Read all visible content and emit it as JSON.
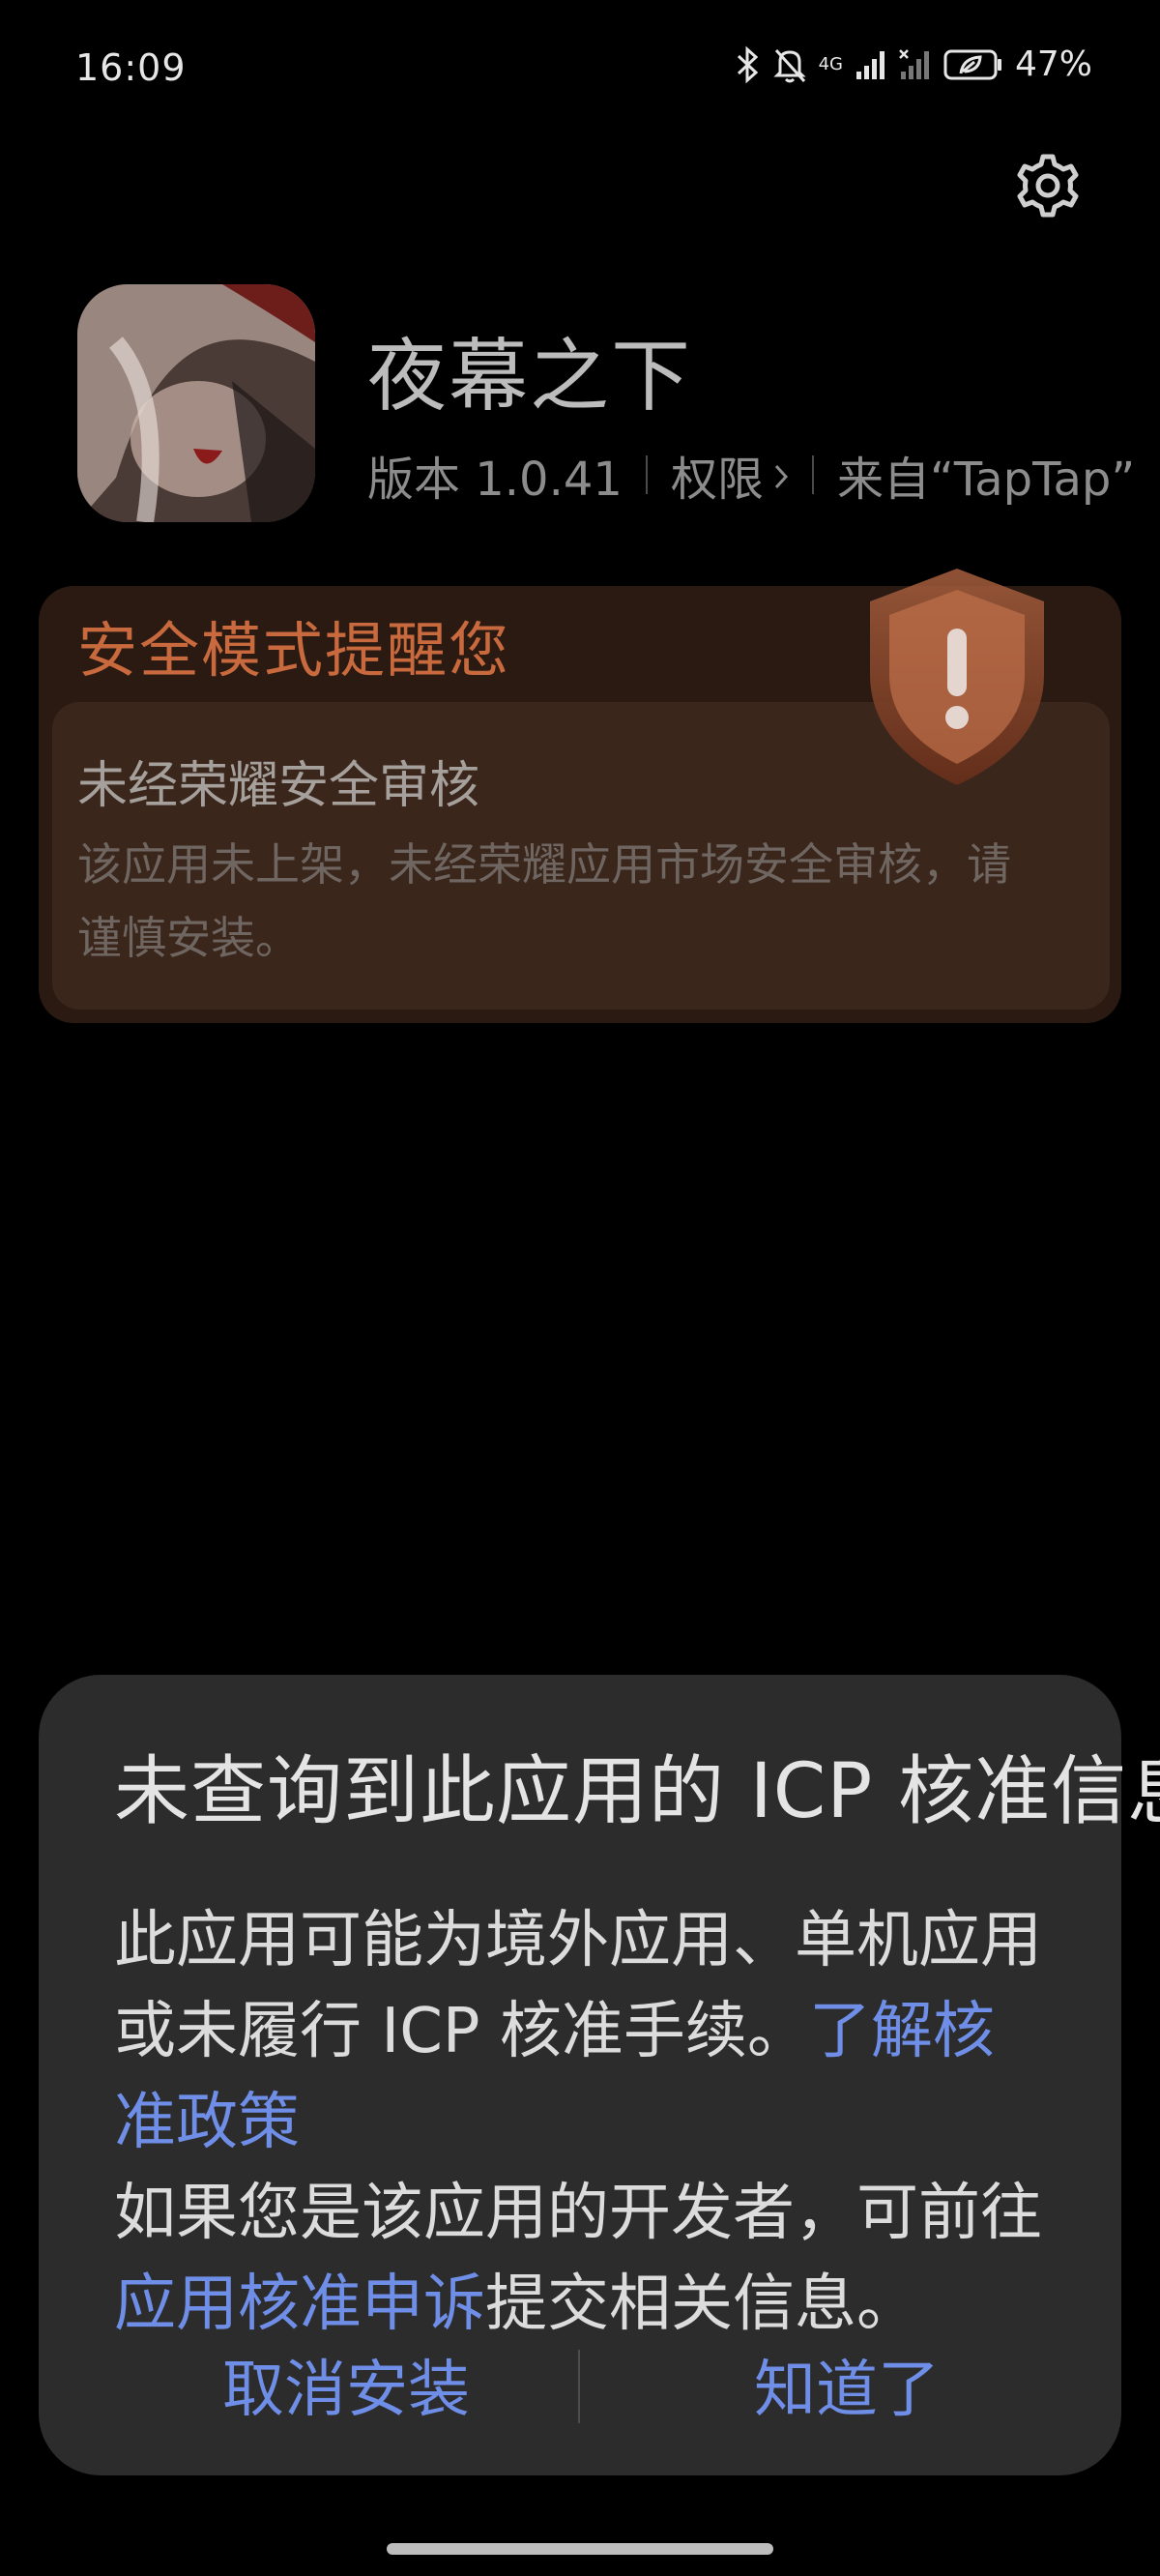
{
  "status_bar": {
    "time": "16:09",
    "network": "4G",
    "battery": "47%",
    "icons": [
      "bluetooth-icon",
      "mute-bell-icon",
      "signal-icon",
      "signal-off-icon",
      "battery-icon"
    ]
  },
  "app": {
    "name": "夜幕之下",
    "version": "版本 1.0.41",
    "permissions": "权限",
    "source": "来自“TapTap”"
  },
  "warning": {
    "title": "安全模式提醒您",
    "subtitle": "未经荣耀安全审核",
    "body": "该应用未上架，未经荣耀应用市场安全审核，请谨慎安装。",
    "accent": "#c96a3e"
  },
  "dialog": {
    "title": "未查询到此应用的 ICP 核准信息",
    "body_1": "此应用可能为境外应用、单机应用或未履行 ICP 核准手续。",
    "link_1": "了解核准政策",
    "body_2": "如果您是该应用的开发者，可前往",
    "link_2": "应用核准申诉",
    "body_3": "提交相关信息。",
    "cancel_label": "取消安装",
    "ok_label": "知道了",
    "link_color": "#6f8ee8"
  }
}
